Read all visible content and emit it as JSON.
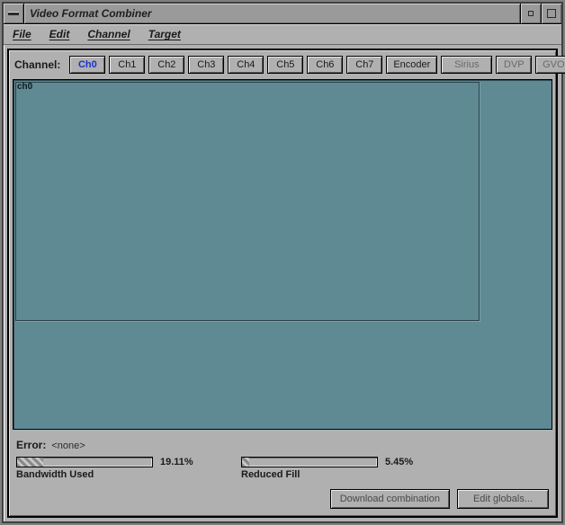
{
  "window": {
    "title": "Video Format Combiner"
  },
  "menubar": {
    "items": [
      "File",
      "Edit",
      "Channel",
      "Target"
    ]
  },
  "channel_row": {
    "label": "Channel:",
    "buttons": [
      "Ch0",
      "Ch1",
      "Ch2",
      "Ch3",
      "Ch4",
      "Ch5",
      "Ch6",
      "Ch7",
      "Encoder",
      "Sirius",
      "DVP",
      "GVO"
    ],
    "active_index": 0
  },
  "canvas": {
    "panel_label": "ch0"
  },
  "status": {
    "error_label": "Error:",
    "error_value": "<none>",
    "bandwidth": {
      "caption": "Bandwidth Used",
      "value_text": "19.11%",
      "percent": 19.11
    },
    "reduced_fill": {
      "caption": "Reduced Fill",
      "value_text": "5.45%",
      "percent": 5.45
    },
    "download_btn": "Download combination",
    "edit_globals_btn": "Edit globals..."
  }
}
